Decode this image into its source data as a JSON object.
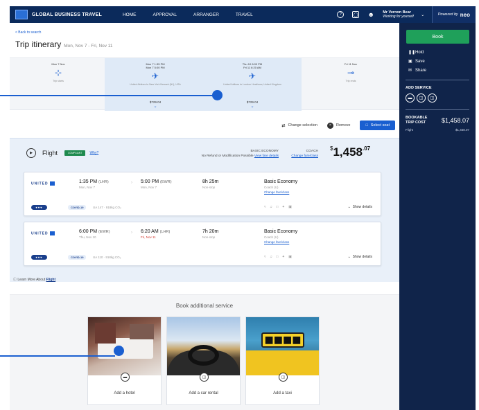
{
  "topnav": {
    "brand": "GLOBAL BUSINESS TRAVEL",
    "links": [
      "HOME",
      "APPROVAL",
      "ARRANGER",
      "TRAVEL"
    ],
    "user_name": "Mr Vernon Bear",
    "user_sub": "Working for yourself",
    "powered_by": "Powered by",
    "powered_brand": "neo"
  },
  "header": {
    "back_link": "< Back to search",
    "title": "Trip itinerary",
    "dates": "Mon, Nov 7 - Fri, Nov 11"
  },
  "timeline": {
    "start": {
      "date": "Mon 7 Nov",
      "sub": "Trip starts"
    },
    "out": {
      "date": "Mon 7  1:35 PM",
      "date2": "Mon 7  5:00 PM",
      "sub": "United Airlines to New York Newark (NJ), USA",
      "price": "$729.04"
    },
    "back": {
      "date": "Thu 10  6:00 PM",
      "date2": "Fri 11  6:20 AM",
      "sub": "United Airlines to London Heathrow, United Kingdom",
      "price": "$729.04"
    },
    "end": {
      "date": "Fri 11 Nov",
      "sub": "Trip ends"
    }
  },
  "actions": {
    "change_selection": "Change selection",
    "remove": "Remove",
    "select_seat": "Select seat"
  },
  "flight": {
    "label": "Flight",
    "compliant": "COMPLIANT",
    "why": "Why?",
    "fare_class": "BASIC ECONOMY",
    "fare_note": "No Refund or Modification Possible",
    "fare_link": "View fare details",
    "cabin_class": "COACH",
    "cabin_link": "Change fare/class",
    "price_dollars": "$",
    "price_int": "1,458",
    "price_cents": ".07",
    "legs": [
      {
        "airline": "UNITED",
        "dep_time": "1:35 PM",
        "dep_code": "(LHR)",
        "dep_date": "Mon, Nov 7",
        "arr_time": "5:00 PM",
        "arr_code": "(EWR)",
        "arr_date": "Mon, Nov 7",
        "duration": "8h 25m",
        "stops": "Non-stop",
        "cabin": "Basic Economy",
        "cabin_sub": "Coach (U)",
        "cabin_link": "Change fare/class",
        "covid": "COVID-19",
        "flight_info": "UA 147 · 918kg CO₂",
        "show_details": "Show details"
      },
      {
        "airline": "UNITED",
        "dep_time": "6:00 PM",
        "dep_code": "(EWR)",
        "dep_date": "Thu, Nov 10",
        "arr_time": "6:20 AM",
        "arr_code": "(LHR)",
        "arr_date": "Fri, Nov 11",
        "duration": "7h 20m",
        "stops": "Non-stop",
        "cabin": "Basic Economy",
        "cabin_sub": "Coach (U)",
        "cabin_link": "Change fare/class",
        "covid": "COVID-19",
        "flight_info": "UA 110 · 918kg CO₂",
        "show_details": "Show details"
      }
    ],
    "learn_more": "Learn More About",
    "learn_link": "Flight"
  },
  "additional": {
    "title": "Book additional service",
    "cards": [
      {
        "label": "Add a hotel",
        "icon": "bed-icon"
      },
      {
        "label": "Add a car rental",
        "icon": "car-icon"
      },
      {
        "label": "Add a taxi",
        "icon": "taxi-icon"
      }
    ]
  },
  "sidebar": {
    "book": "Book",
    "hold": "Hold",
    "save": "Save",
    "share": "Share",
    "add_service": "ADD SERVICE",
    "bookable_label_1": "BOOKABLE",
    "bookable_label_2": "TRIP COST",
    "bookable_amount": "$1,458.07",
    "flight_label": "Flight",
    "flight_amount": "$1,458.07"
  },
  "colors": {
    "nav_bg": "#0b2a5b",
    "sidebar_bg": "#10244a",
    "accent_blue": "#1a5fd0",
    "book_green": "#1fa05a",
    "compliant_green": "#1e8a4e"
  }
}
